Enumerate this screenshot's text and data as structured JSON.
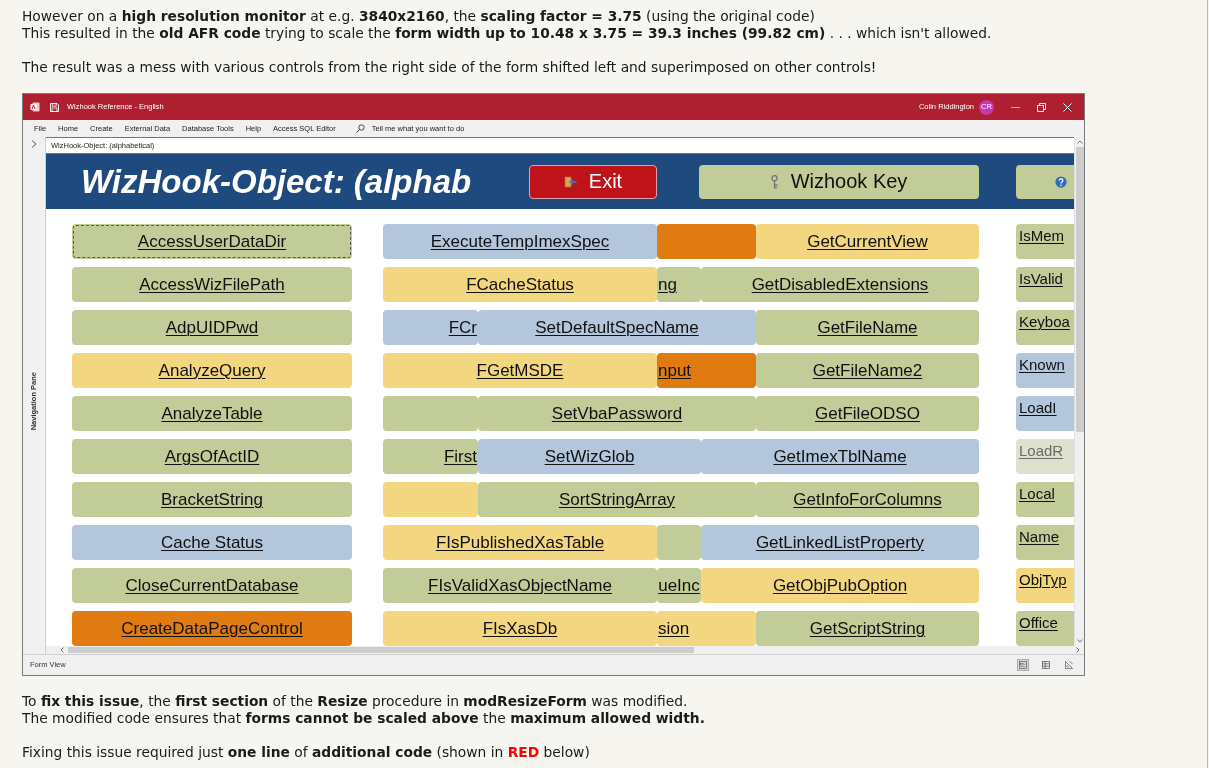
{
  "intro": [
    {
      "lines": [
        "However on a **high resolution monitor** at e.g. **3840x2160**, the **scaling factor = 3.75** (using the original code)",
        "This resulted in the **old AFR code** trying to scale the **form width up to 10.48 x 3.75 = 39.3 inches (99.82 cm)** . . . which isn't allowed."
      ]
    },
    {
      "lines": [
        "The result was a mess with various controls from the right side of the form shifted left and superimposed on other controls!"
      ]
    }
  ],
  "access_window": {
    "title": "Wizhook Reference - English",
    "user": {
      "name": "Colin Riddington",
      "initials": "CR"
    },
    "ribbon_tabs": [
      "File",
      "Home",
      "Create",
      "External Data",
      "Database Tools",
      "Help",
      "Access SQL Editor"
    ],
    "tell_me": {
      "placeholder": "Tell me what you want to do"
    },
    "navigation_pane": {
      "label": "Navigation Pane",
      "expanded": false
    },
    "document_tab": "WizHook-Object: (alphabetical)",
    "form": {
      "heading": "WizHook-Object: (alphab",
      "header_buttons": [
        {
          "kind": "exit",
          "label": "Exit",
          "color": "#be1419"
        },
        {
          "kind": "key",
          "label": "Wizhook Key",
          "color": "#c2cc99"
        },
        {
          "kind": "help",
          "color": "#c2cc99"
        }
      ],
      "column_1": [
        {
          "label": "AccessUserDataDir",
          "color": "#c2cc99",
          "focused": true
        },
        {
          "label": "AccessWizFilePath",
          "color": "#c2cc99",
          "focused": false
        },
        {
          "label": "AdpUIDPwd",
          "color": "#c2cc99",
          "focused": false
        },
        {
          "label": "AnalyzeQuery",
          "color": "#f2d680",
          "focused": false
        },
        {
          "label": "AnalyzeTable",
          "color": "#c2cc99",
          "focused": false
        },
        {
          "label": "ArgsOfActID",
          "color": "#c2cc99",
          "focused": false
        },
        {
          "label": "BracketString",
          "color": "#c2cc99",
          "focused": false
        },
        {
          "label": "Cache Status",
          "color": "#b4c6dc",
          "focused": false
        },
        {
          "label": "CloseCurrentDatabase",
          "color": "#c2cc99",
          "focused": false
        },
        {
          "label": "CreateDataPageControl",
          "color": "#df7b10",
          "focused": false
        }
      ],
      "middle_rows": [
        {
          "segments": [
            {
              "label": "ExecuteTempImexSpec",
              "color": "#b4c6dc"
            },
            {
              "color": "#df7b10"
            },
            {
              "label": "GetCurrentView",
              "color": "#f2d680"
            }
          ]
        },
        {
          "segments": [
            {
              "label": "FCacheStatus",
              "color": "#f2d680"
            },
            {
              "label": "ng",
              "color": "#c2cc99"
            },
            {
              "label": "GetDisabledExtensions",
              "color": "#c2cc99"
            }
          ]
        },
        {
          "segments": [
            {
              "label": "FCr",
              "color": "#b4c6dc"
            },
            {
              "label": "SetDefaultSpecName",
              "color": "#b4c6dc"
            },
            {
              "label": "GetFileName",
              "color": "#c2cc99"
            }
          ]
        },
        {
          "segments": [
            {
              "label": "FGetMSDE",
              "color": "#f2d680"
            },
            {
              "label": "nput",
              "color": "#df7b10"
            },
            {
              "label": "GetFileName2",
              "color": "#c2cc99"
            }
          ]
        },
        {
          "segments": [
            {
              "color": "#c2cc99"
            },
            {
              "label": "SetVbaPassword",
              "color": "#c2cc99"
            },
            {
              "label": "GetFileODSO",
              "color": "#c2cc99"
            }
          ]
        },
        {
          "segments": [
            {
              "label": "First",
              "color": "#c2cc99"
            },
            {
              "label": "SetWizGlob",
              "color": "#b4c6dc"
            },
            {
              "label": "GetImexTblName",
              "color": "#b4c6dc"
            }
          ]
        },
        {
          "segments": [
            {
              "color": "#f2d680"
            },
            {
              "label": "SortStringArray",
              "color": "#c2cc99"
            },
            {
              "label": "GetInfoForColumns",
              "color": "#c2cc99"
            }
          ]
        },
        {
          "segments": [
            {
              "label": "FIsPublishedXasTable",
              "color": "#f2d680"
            },
            {
              "color": "#c2cc99"
            },
            {
              "label": "GetLinkedListProperty",
              "color": "#b4c6dc"
            }
          ]
        },
        {
          "segments": [
            {
              "label": "FIsValidXasObjectName",
              "color": "#c2cc99"
            },
            {
              "label": "ueInc",
              "color": "#c2cc99"
            },
            {
              "label": "GetObjPubOption",
              "color": "#f2d680"
            }
          ]
        },
        {
          "segments": [
            {
              "label": "FIsXasDb",
              "color": "#f2d680"
            },
            {
              "label": "sion",
              "color": "#f2d680"
            },
            {
              "label": "GetScriptString",
              "color": "#c2cc99"
            }
          ]
        }
      ],
      "column_3": [
        {
          "label": "IsMem",
          "color": "#c2cc99",
          "disabled": false
        },
        {
          "label": "IsValid",
          "color": "#c2cc99",
          "disabled": false
        },
        {
          "label": "Keyboa",
          "color": "#c2cc99",
          "disabled": false
        },
        {
          "label": "Known",
          "color": "#b4c6dc",
          "disabled": false
        },
        {
          "label": "LoadI",
          "color": "#b4c6dc",
          "disabled": false
        },
        {
          "label": "LoadR",
          "color": "#dde2d0",
          "disabled": true
        },
        {
          "label": "Local",
          "color": "#c2cc99",
          "disabled": false
        },
        {
          "label": "Name",
          "color": "#c2cc99",
          "disabled": false
        },
        {
          "label": "ObjTyp",
          "color": "#f2d680",
          "disabled": false
        },
        {
          "label": "Office",
          "color": "#c2cc99",
          "disabled": false
        }
      ]
    },
    "status_bar": {
      "text": "Form View",
      "views": [
        {
          "kind": "form",
          "selected": true
        },
        {
          "kind": "layout",
          "selected": false
        },
        {
          "kind": "design",
          "selected": false
        }
      ]
    }
  },
  "outro": [
    {
      "lines": [
        "To **fix this issue**, the **first section** of the **Resize** procedure in **modResizeForm** was modified.",
        "The modified code ensures that **forms cannot be scaled above** the **maximum allowed width.**"
      ]
    },
    {
      "lines": [
        {
          "parts": [
            {
              "text": "Fixing this issue required just **one line** of **additional code** (shown in "
            },
            {
              "text": "**RED**",
              "color": "#ff0000"
            },
            {
              "text": " below)"
            }
          ]
        }
      ]
    }
  ]
}
